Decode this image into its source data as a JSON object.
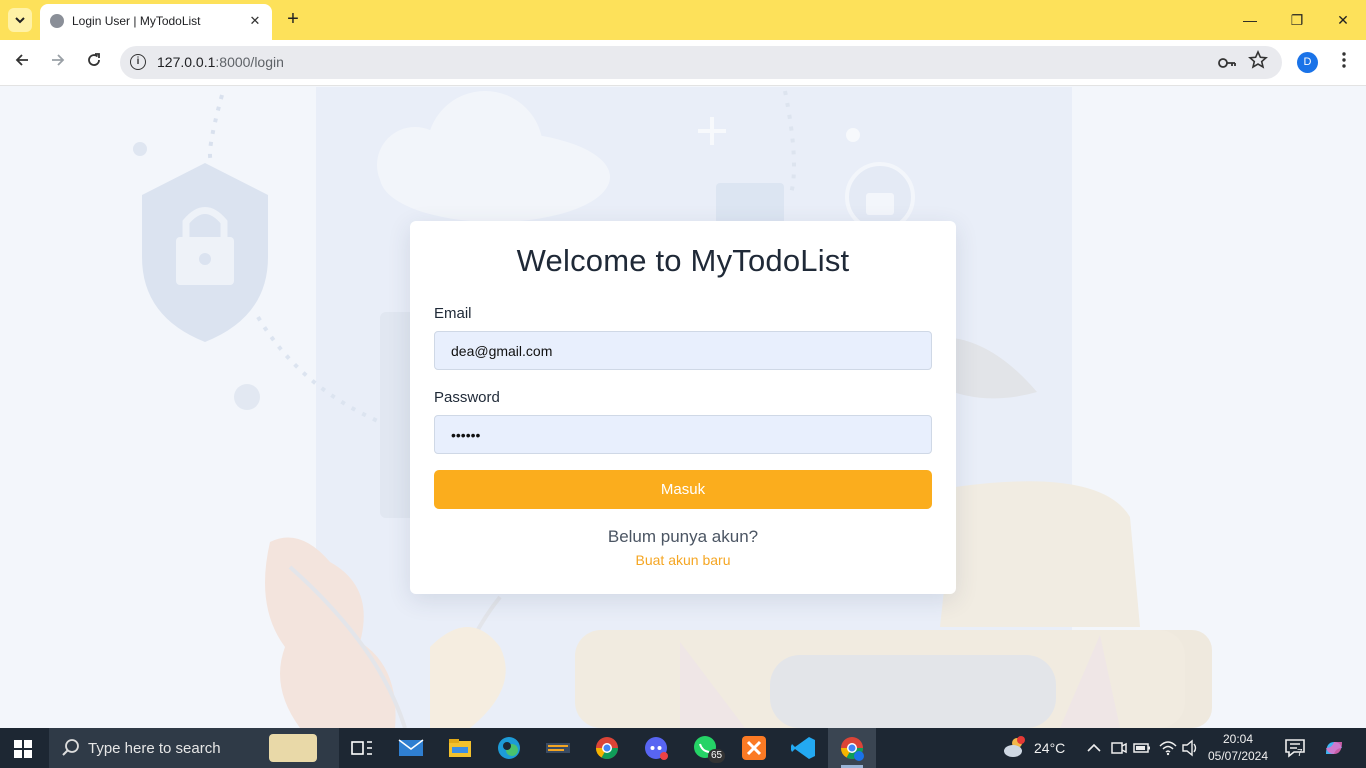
{
  "browser": {
    "tab_title": "Login User | MyTodoList",
    "tab_close_glyph": "✕",
    "new_tab_glyph": "+",
    "url_host": "127.0.0.1",
    "url_rest": ":8000/login",
    "profile_initial": "D",
    "window_controls": {
      "minimize": "—",
      "restore": "❐",
      "close": "✕"
    }
  },
  "login": {
    "title": "Welcome to MyTodoList",
    "email_label": "Email",
    "email_value": "dea@gmail.com",
    "password_label": "Password",
    "password_value": "••••••",
    "submit_label": "Masuk",
    "register_prompt": "Belum punya akun?",
    "register_link": "Buat akun baru"
  },
  "colors": {
    "titlebar": "#fde15a",
    "accent_button": "#fbad1d",
    "link": "#f5a623",
    "field_bg": "#e8effd",
    "taskbar": "#1d2733"
  },
  "taskbar": {
    "search_placeholder": "Type here to search",
    "whatsapp_badge": "65",
    "temperature": "24°C",
    "time": "20:04",
    "date": "05/07/2024",
    "notification_count": "7",
    "apps": [
      "task-view-icon",
      "mail-icon",
      "file-explorer-icon",
      "edge-icon",
      "sublime-icon",
      "chrome-icon",
      "discord-icon",
      "whatsapp-icon",
      "xampp-icon",
      "vscode-icon",
      "chrome-profile-icon"
    ]
  }
}
